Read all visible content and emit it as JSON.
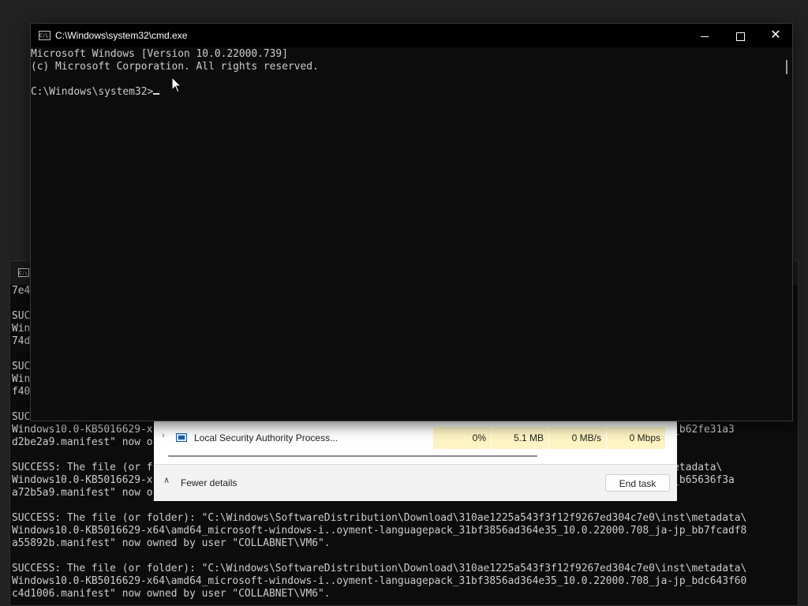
{
  "background_console": {
    "lines": [
      "7e4",
      "",
      "SUCC",
      "Wind",
      "74d",
      "",
      "SUCC",
      "Wind",
      "f40",
      "",
      "SUCC",
      "Windows10.0-KB5016629-x                                                                                ja-jp_b62fe31a3",
      "d2be2a9.manifest\" now o",
      "",
      "SUCCESS: The file (or f                                                                               inst\\metadata\\",
      "Windows10.0-KB5016629-x                                                                                ja-jp_b65636f3a",
      "a72b5a9.manifest\" now o",
      "",
      "SUCCESS: The file (or folder): \"C:\\Windows\\SoftwareDistribution\\Download\\310ae1225a543f3f12f9267ed304c7e0\\inst\\metadata\\",
      "Windows10.0-KB5016629-x64\\amd64_microsoft-windows-i..oyment-languagepack_31bf3856ad364e35_10.0.22000.708_ja-jp_bb7fcadf8",
      "a55892b.manifest\" now owned by user \"COLLABNET\\VM6\".",
      "",
      "SUCCESS: The file (or folder): \"C:\\Windows\\SoftwareDistribution\\Download\\310ae1225a543f3f12f9267ed304c7e0\\inst\\metadata\\",
      "Windows10.0-KB5016629-x64\\amd64_microsoft-windows-i..oyment-languagepack_31bf3856ad364e35_10.0.22000.708_ja-jp_bdc643f60",
      "c4d1006.manifest\" now owned by user \"COLLABNET\\VM6\"."
    ]
  },
  "task_manager": {
    "process_name": "Local Security Authority Process...",
    "cpu": "0%",
    "memory": "5.1 MB",
    "disk": "0 MB/s",
    "network": "0 Mbps",
    "fewer_details_label": "Fewer details",
    "end_task_label": "End task",
    "highlight_color": "#fff4c4"
  },
  "main_console": {
    "title": "C:\\Windows\\system32\\cmd.exe",
    "line1": "Microsoft Windows [Version 10.0.22000.739]",
    "line2": "(c) Microsoft Corporation. All rights reserved.",
    "prompt": "C:\\Windows\\system32>",
    "text_color": "#cccccc",
    "background_color": "#0c0c0c"
  },
  "icons": {
    "console_app_icon": "console-icon",
    "minimize": "minimize-icon",
    "maximize": "maximize-icon",
    "close": "close-icon"
  }
}
